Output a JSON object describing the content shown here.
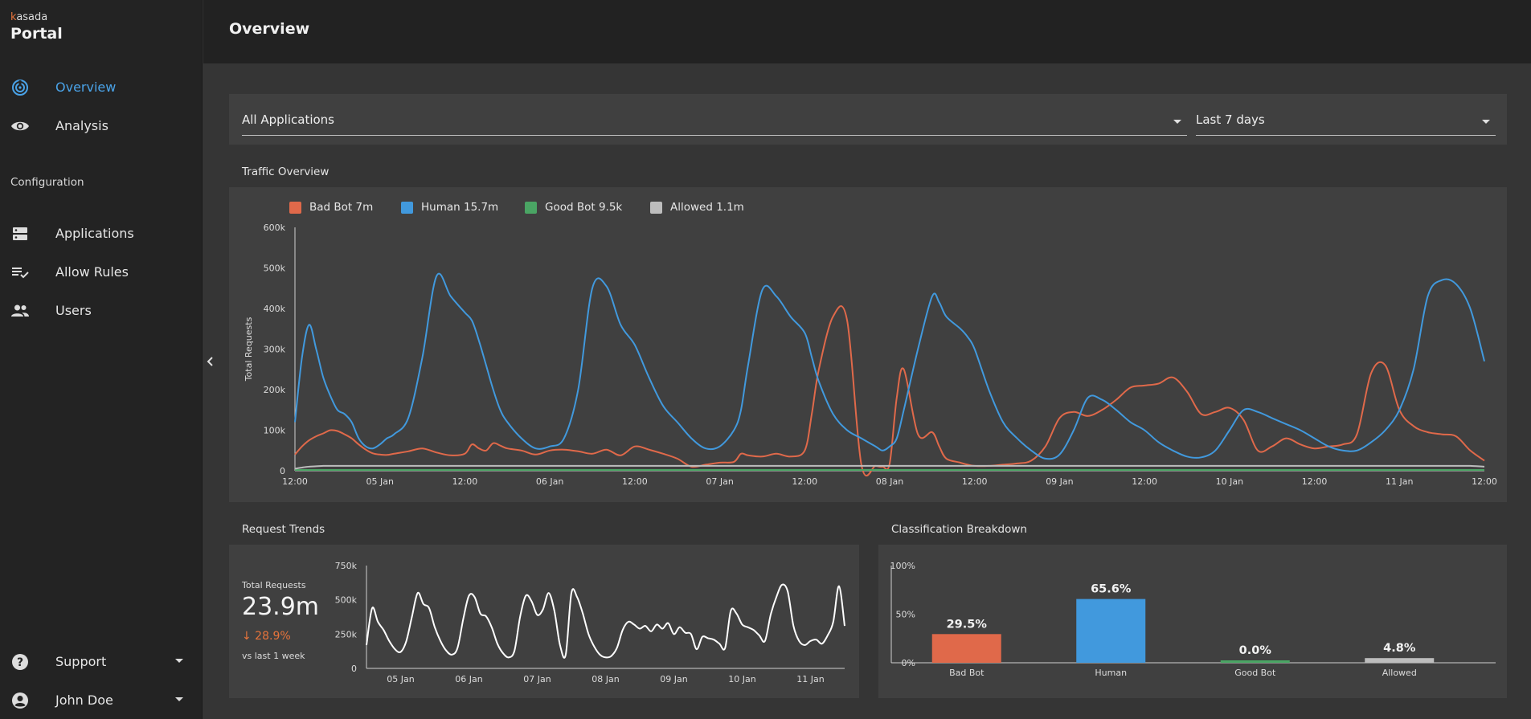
{
  "brand": {
    "small_prefix": "k",
    "small_rest": "asada",
    "title": "Portal"
  },
  "sidebar": {
    "items": [
      {
        "label": "Overview",
        "icon": "overview-icon",
        "active": true
      },
      {
        "label": "Analysis",
        "icon": "eye-icon"
      }
    ],
    "config_label": "Configuration",
    "config_items": [
      {
        "label": "Applications",
        "icon": "server-icon"
      },
      {
        "label": "Allow Rules",
        "icon": "playlist-check-icon"
      },
      {
        "label": "Users",
        "icon": "users-icon"
      }
    ],
    "bottom_items": [
      {
        "label": "Support",
        "icon": "help-icon"
      },
      {
        "label": "John Doe",
        "icon": "account-icon"
      }
    ]
  },
  "header": {
    "title": "Overview"
  },
  "filters": {
    "application": "All Applications",
    "period": "Last 7 days"
  },
  "traffic": {
    "title": "Traffic Overview",
    "legend": [
      {
        "label": "Bad Bot 7m",
        "color": "#e0694a"
      },
      {
        "label": "Human 15.7m",
        "color": "#4199dd"
      },
      {
        "label": "Good Bot 9.5k",
        "color": "#4aa564"
      },
      {
        "label": "Allowed 1.1m",
        "color": "#bdbdbd"
      }
    ]
  },
  "trends": {
    "title": "Request Trends",
    "total_label": "Total Requests",
    "total_value": "23.9m",
    "change": "↓ 28.9%",
    "change_sub": "vs last 1 week"
  },
  "breakdown": {
    "title": "Classification Breakdown"
  },
  "chart_data": [
    {
      "type": "line",
      "title": "Traffic Overview",
      "ylabel": "Total Requests",
      "ylim": [
        0,
        600000
      ],
      "ytick_labels": [
        "0",
        "100k",
        "200k",
        "300k",
        "400k",
        "500k",
        "600k"
      ],
      "xlim": [
        0,
        168
      ],
      "xtick_positions": [
        0,
        12,
        24,
        36,
        48,
        60,
        72,
        84,
        96,
        108,
        120,
        132,
        144,
        156,
        168
      ],
      "xtick_labels": [
        "12:00",
        "05 Jan",
        "12:00",
        "06 Jan",
        "12:00",
        "07 Jan",
        "12:00",
        "08 Jan",
        "12:00",
        "09 Jan",
        "12:00",
        "10 Jan",
        "12:00",
        "11 Jan",
        "12:00"
      ],
      "grid": false,
      "legend_position": "top-left",
      "x": [
        0,
        1,
        2,
        3,
        4,
        5,
        6,
        7,
        8,
        9,
        10,
        11,
        12,
        13,
        14,
        16,
        18,
        20,
        22,
        24,
        25,
        26,
        27,
        28,
        29,
        30,
        32,
        34,
        36,
        38,
        40,
        42,
        44,
        46,
        48,
        50,
        52,
        54,
        56,
        58,
        60,
        62,
        63,
        64,
        66,
        68,
        70,
        72,
        73,
        74,
        76,
        78,
        80,
        82,
        83,
        84,
        85,
        86,
        88,
        90,
        91,
        92,
        94,
        95,
        96,
        98,
        100,
        102,
        104,
        106,
        108,
        110,
        112,
        114,
        116,
        118,
        120,
        122,
        124,
        126,
        128,
        130,
        132,
        134,
        136,
        138,
        140,
        142,
        144,
        146,
        148,
        150,
        152,
        154,
        156,
        158,
        160,
        162,
        164,
        166,
        168
      ],
      "series": [
        {
          "name": "Bad Bot 7m",
          "color": "#e0694a",
          "values": [
            40000,
            60000,
            75000,
            85000,
            92000,
            100000,
            98000,
            90000,
            80000,
            65000,
            52000,
            43000,
            40000,
            39000,
            42000,
            48000,
            55000,
            45000,
            38000,
            42000,
            65000,
            55000,
            50000,
            68000,
            62000,
            55000,
            50000,
            40000,
            50000,
            52000,
            48000,
            42000,
            52000,
            38000,
            60000,
            52000,
            42000,
            30000,
            10000,
            15000,
            20000,
            22000,
            42000,
            38000,
            35000,
            42000,
            35000,
            50000,
            140000,
            250000,
            380000,
            370000,
            15000,
            12000,
            10000,
            18000,
            180000,
            250000,
            90000,
            95000,
            60000,
            30000,
            20000,
            15000,
            12000,
            12000,
            15000,
            18000,
            25000,
            60000,
            130000,
            145000,
            135000,
            150000,
            175000,
            205000,
            210000,
            215000,
            230000,
            195000,
            140000,
            145000,
            155000,
            125000,
            50000,
            60000,
            80000,
            65000,
            55000,
            60000,
            65000,
            90000,
            240000,
            260000,
            150000,
            110000,
            95000,
            90000,
            85000,
            50000,
            25000
          ]
        },
        {
          "name": "Human 15.7m",
          "color": "#4199dd",
          "values": [
            120000,
            280000,
            360000,
            300000,
            230000,
            185000,
            150000,
            140000,
            120000,
            80000,
            60000,
            55000,
            65000,
            80000,
            90000,
            130000,
            280000,
            480000,
            430000,
            390000,
            370000,
            320000,
            260000,
            200000,
            150000,
            120000,
            80000,
            55000,
            60000,
            80000,
            200000,
            450000,
            455000,
            360000,
            310000,
            230000,
            160000,
            120000,
            80000,
            55000,
            60000,
            100000,
            150000,
            260000,
            445000,
            430000,
            380000,
            340000,
            280000,
            220000,
            140000,
            100000,
            80000,
            60000,
            50000,
            60000,
            80000,
            150000,
            300000,
            430000,
            415000,
            380000,
            350000,
            330000,
            300000,
            200000,
            120000,
            80000,
            50000,
            30000,
            40000,
            100000,
            180000,
            175000,
            150000,
            120000,
            100000,
            70000,
            50000,
            35000,
            33000,
            50000,
            100000,
            150000,
            145000,
            130000,
            115000,
            100000,
            80000,
            60000,
            50000,
            50000,
            70000,
            100000,
            150000,
            250000,
            430000,
            470000,
            460000,
            400000,
            270000
          ]
        },
        {
          "name": "Good Bot 9.5k",
          "color": "#4aa564",
          "values": [
            2000,
            2000,
            2000,
            2000,
            2000,
            2000,
            2000,
            2000,
            2000,
            2000,
            2000,
            2000,
            2000,
            2000,
            2000,
            2000,
            2000,
            2000,
            2000,
            2000,
            2000,
            2000,
            2000,
            2000,
            2000,
            2000,
            2000,
            2000,
            2000,
            2000,
            2000,
            2000,
            2000,
            2000,
            2000,
            2000,
            2000,
            2000,
            2000,
            2000,
            2000,
            2000,
            2000,
            2000,
            2000,
            2000,
            2000,
            2000,
            2000,
            2000,
            2000,
            2000,
            2000,
            2000,
            2000,
            2000,
            2000,
            2000,
            2000,
            2000,
            2000,
            2000,
            2000,
            2000,
            2000,
            2000,
            2000,
            2000,
            2000,
            2000,
            2000,
            2000,
            2000,
            2000,
            2000,
            2000,
            2000,
            2000,
            2000,
            2000,
            2000,
            2000,
            2000,
            2000,
            2000,
            2000,
            2000,
            2000,
            2000,
            2000,
            2000,
            2000,
            2000,
            2000,
            2000,
            2000,
            2000,
            2000,
            2000,
            2000,
            2000
          ]
        },
        {
          "name": "Allowed 1.1m",
          "color": "#bdbdbd",
          "values": [
            5000,
            8000,
            10000,
            11000,
            12000,
            12000,
            12000,
            12000,
            12000,
            12000,
            12000,
            12000,
            12000,
            12000,
            12000,
            12000,
            12000,
            12000,
            12000,
            12000,
            12000,
            12000,
            12000,
            12000,
            12000,
            12000,
            12000,
            12000,
            12000,
            12000,
            12000,
            12000,
            12000,
            12000,
            12000,
            12000,
            12000,
            12000,
            12000,
            12000,
            12000,
            12000,
            12000,
            12000,
            12000,
            12000,
            12000,
            12000,
            12000,
            12000,
            12000,
            12000,
            12000,
            12000,
            12000,
            12000,
            12000,
            12000,
            12000,
            12000,
            12000,
            12000,
            12000,
            12000,
            12000,
            12000,
            12000,
            12000,
            12000,
            12000,
            12000,
            12000,
            12000,
            12000,
            12000,
            12000,
            12000,
            12000,
            12000,
            12000,
            12000,
            12000,
            12000,
            12000,
            12000,
            12000,
            12000,
            12000,
            12000,
            12000,
            12000,
            12000,
            12000,
            12000,
            12000,
            12000,
            12000,
            12000,
            12000,
            12000,
            10000
          ]
        }
      ]
    },
    {
      "type": "line",
      "title": "Request Trends",
      "ylim": [
        0,
        750000
      ],
      "ytick_labels": [
        "0",
        "250k",
        "500k",
        "750k"
      ],
      "xlim": [
        0,
        168
      ],
      "xtick_positions": [
        12,
        36,
        60,
        84,
        108,
        132,
        156
      ],
      "xtick_labels": [
        "05 Jan",
        "06 Jan",
        "07 Jan",
        "08 Jan",
        "09 Jan",
        "10 Jan",
        "11 Jan"
      ],
      "x": [
        0,
        2,
        4,
        6,
        8,
        10,
        12,
        14,
        16,
        18,
        20,
        22,
        24,
        26,
        28,
        30,
        32,
        34,
        36,
        38,
        40,
        42,
        44,
        46,
        48,
        50,
        52,
        54,
        56,
        58,
        60,
        62,
        64,
        66,
        68,
        70,
        72,
        74,
        76,
        78,
        80,
        82,
        84,
        86,
        88,
        90,
        92,
        94,
        96,
        98,
        100,
        102,
        104,
        106,
        108,
        110,
        112,
        114,
        116,
        118,
        120,
        122,
        124,
        126,
        128,
        130,
        132,
        134,
        136,
        138,
        140,
        142,
        144,
        146,
        148,
        150,
        152,
        154,
        156,
        158,
        160,
        162,
        164,
        166,
        168
      ],
      "series": [
        {
          "name": "",
          "color": "#ffffff",
          "values": [
            170000,
            440000,
            340000,
            280000,
            200000,
            140000,
            120000,
            200000,
            380000,
            550000,
            470000,
            440000,
            300000,
            200000,
            130000,
            100000,
            150000,
            360000,
            530000,
            520000,
            400000,
            380000,
            300000,
            180000,
            110000,
            80000,
            130000,
            380000,
            530000,
            490000,
            390000,
            430000,
            550000,
            420000,
            170000,
            100000,
            550000,
            520000,
            400000,
            250000,
            160000,
            100000,
            80000,
            90000,
            150000,
            280000,
            340000,
            320000,
            290000,
            310000,
            270000,
            320000,
            290000,
            330000,
            250000,
            300000,
            260000,
            250000,
            140000,
            230000,
            220000,
            210000,
            180000,
            150000,
            420000,
            400000,
            320000,
            300000,
            280000,
            240000,
            200000,
            390000,
            520000,
            610000,
            560000,
            310000,
            200000,
            170000,
            200000,
            210000,
            180000,
            240000,
            340000,
            600000,
            310000
          ]
        }
      ]
    },
    {
      "type": "bar",
      "title": "Classification Breakdown",
      "categories": [
        "Bad Bot",
        "Human",
        "Good Bot",
        "Allowed"
      ],
      "values": [
        29.5,
        65.6,
        0.0,
        4.8
      ],
      "value_labels": [
        "29.5%",
        "65.6%",
        "0.0%",
        "4.8%"
      ],
      "colors": [
        "#e0694a",
        "#4199dd",
        "#4aa564",
        "#bdbdbd"
      ],
      "ylim": [
        0,
        100
      ],
      "ytick_labels": [
        "0%",
        "50%",
        "100%"
      ]
    }
  ]
}
